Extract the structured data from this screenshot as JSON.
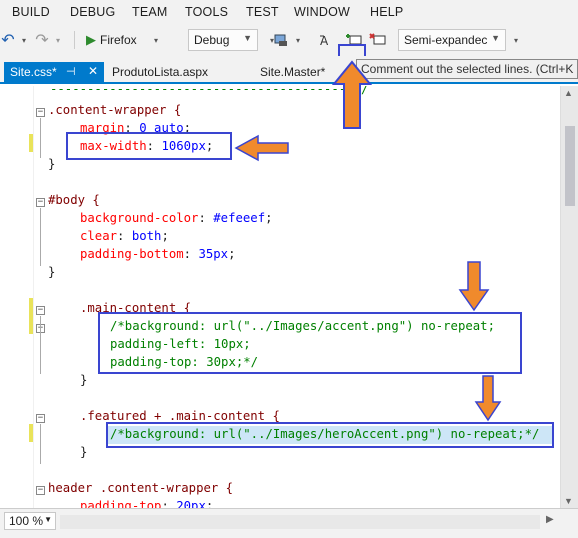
{
  "menu": [
    "BUILD",
    "DEBUG",
    "TEAM",
    "TOOLS",
    "TEST",
    "WINDOW",
    "HELP"
  ],
  "toolbar": {
    "run_label": "Firefox",
    "config_value": "Debug",
    "outlining_value": "Semi-expandec"
  },
  "tabs": [
    {
      "label": "Site.css*",
      "active": true
    },
    {
      "label": "ProdutoLista.aspx",
      "active": false
    },
    {
      "label": "Site.Master*",
      "active": false
    }
  ],
  "tooltip": "Comment out the selected lines. (Ctrl+K",
  "code_lines": {
    "l0": "-----------------------------------------*/",
    "l1_sel": ".content-wrapper {",
    "l2_prop": "margin",
    "l2_val": "0 auto",
    "l3_prop": "max-width",
    "l3_val": "1060px",
    "l4": "}",
    "l6_sel": "#body {",
    "l7_prop": "background-color",
    "l7_val": "#efeeef",
    "l8_prop": "clear",
    "l8_val": "both",
    "l9_prop": "padding-bottom",
    "l9_val": "35px",
    "l10": "}",
    "l12_sel": ".main-content {",
    "l13_cmt": "/*background: url(\"../Images/accent.png\") no-repeat;",
    "l14_cmt": "padding-left: 10px;",
    "l15_cmt": "padding-top: 30px;*/",
    "l16": "}",
    "l18_sel": ".featured + .main-content {",
    "l19_cmt": "/*background: url(\"../Images/heroAccent.png\") no-repeat;*/",
    "l20": "}",
    "l22_sel": "header .content-wrapper {",
    "l23_prop": "padding-top",
    "l23_val": "20px"
  },
  "status": {
    "zoom": "100 %"
  },
  "colors": {
    "accent": "#007acc",
    "annotation_arrow": "#f08a2c",
    "annotation_box": "#3a45d0",
    "selection": "#cde6f7"
  }
}
